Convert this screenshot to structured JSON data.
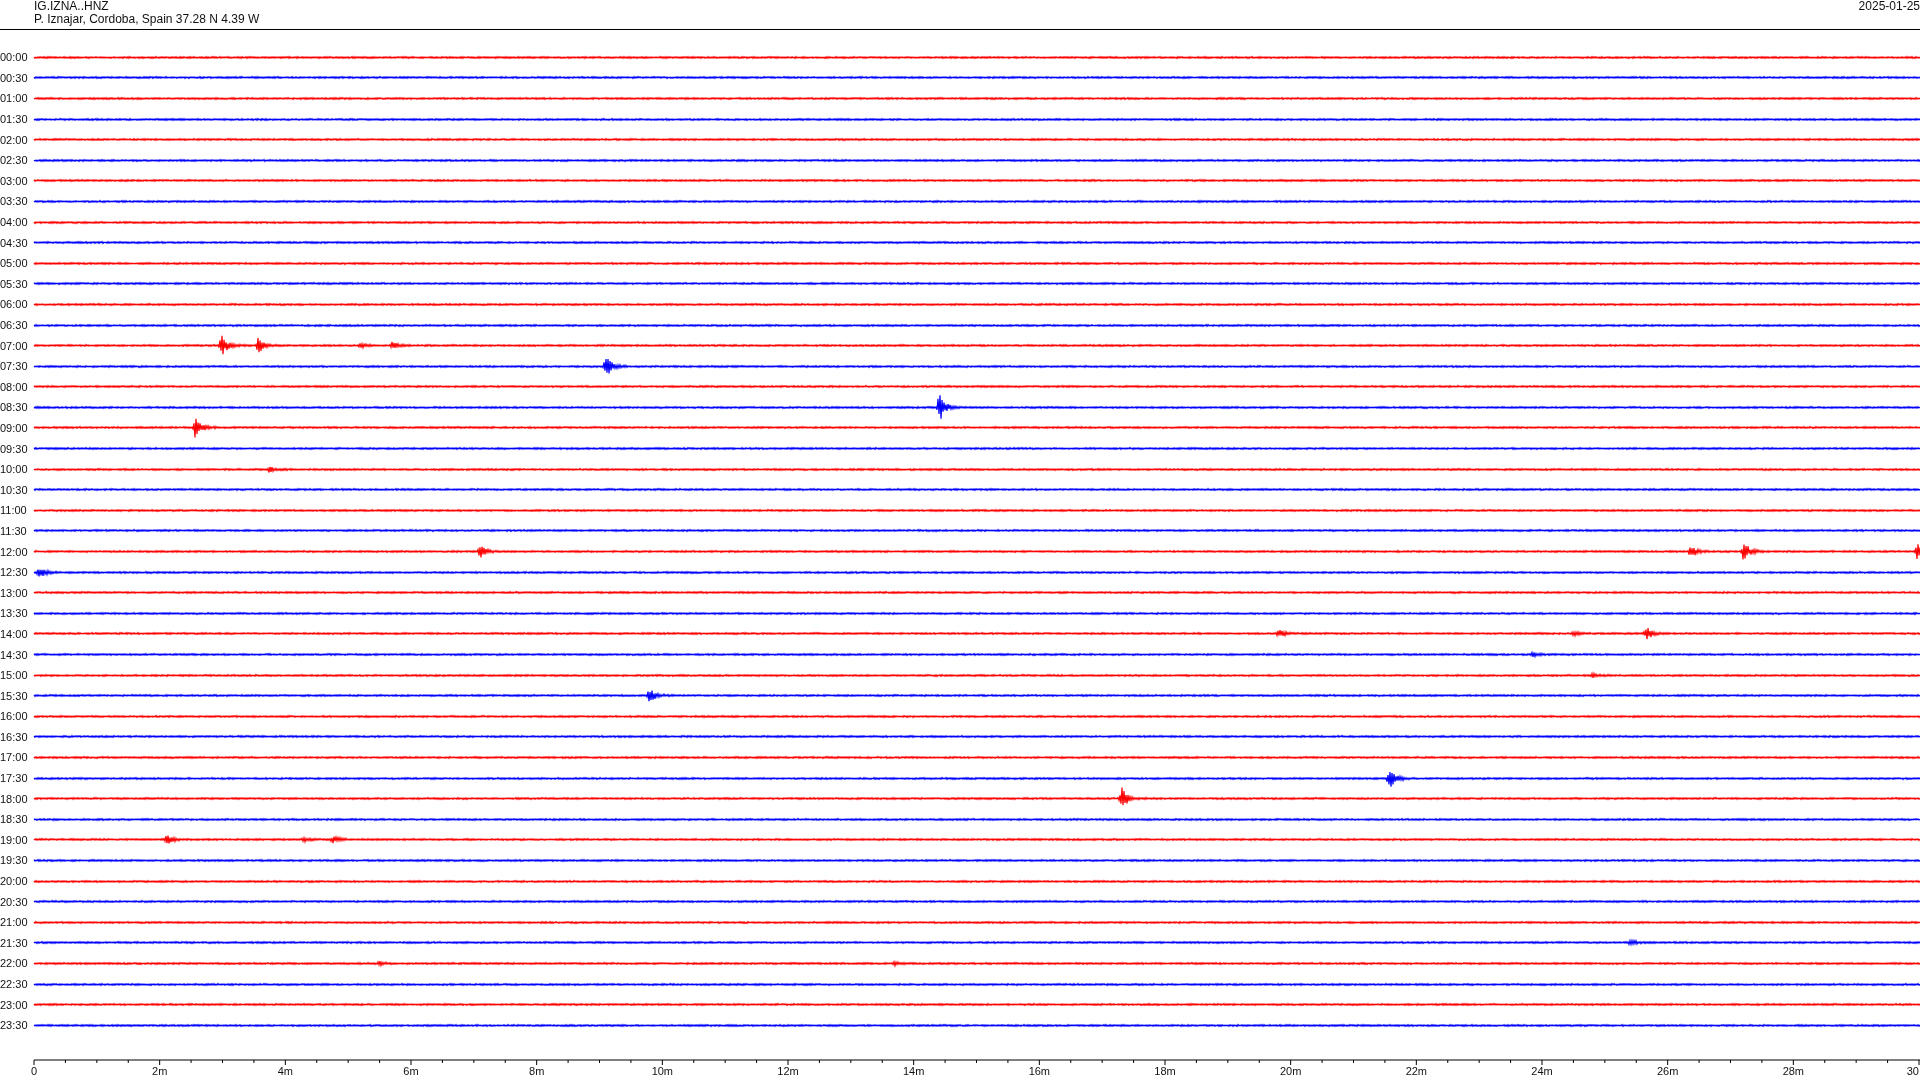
{
  "header": {
    "station": "IG.IZNA..HNZ",
    "location": "P. Iznajar, Cordoba, Spain  37.28 N 4.39 W",
    "date": "2025-01-25"
  },
  "traces": [
    {
      "label": "00:00",
      "color": "#ff0000"
    },
    {
      "label": "00:30",
      "color": "#0000ff"
    },
    {
      "label": "01:00",
      "color": "#ff0000"
    },
    {
      "label": "01:30",
      "color": "#0000ff"
    },
    {
      "label": "02:00",
      "color": "#ff0000"
    },
    {
      "label": "02:30",
      "color": "#0000ff"
    },
    {
      "label": "03:00",
      "color": "#ff0000"
    },
    {
      "label": "03:30",
      "color": "#0000ff"
    },
    {
      "label": "04:00",
      "color": "#ff0000"
    },
    {
      "label": "04:30",
      "color": "#0000ff"
    },
    {
      "label": "05:00",
      "color": "#ff0000"
    },
    {
      "label": "05:30",
      "color": "#0000ff"
    },
    {
      "label": "06:00",
      "color": "#ff0000"
    },
    {
      "label": "06:30",
      "color": "#0000ff"
    },
    {
      "label": "07:00",
      "color": "#ff0000"
    },
    {
      "label": "07:30",
      "color": "#0000ff"
    },
    {
      "label": "08:00",
      "color": "#ff0000"
    },
    {
      "label": "08:30",
      "color": "#0000ff"
    },
    {
      "label": "09:00",
      "color": "#ff0000"
    },
    {
      "label": "09:30",
      "color": "#0000ff"
    },
    {
      "label": "10:00",
      "color": "#ff0000"
    },
    {
      "label": "10:30",
      "color": "#0000ff"
    },
    {
      "label": "11:00",
      "color": "#ff0000"
    },
    {
      "label": "11:30",
      "color": "#0000ff"
    },
    {
      "label": "12:00",
      "color": "#ff0000"
    },
    {
      "label": "12:30",
      "color": "#0000ff"
    },
    {
      "label": "13:00",
      "color": "#ff0000"
    },
    {
      "label": "13:30",
      "color": "#0000ff"
    },
    {
      "label": "14:00",
      "color": "#ff0000"
    },
    {
      "label": "14:30",
      "color": "#0000ff"
    },
    {
      "label": "15:00",
      "color": "#ff0000"
    },
    {
      "label": "15:30",
      "color": "#0000ff"
    },
    {
      "label": "16:00",
      "color": "#ff0000"
    },
    {
      "label": "16:30",
      "color": "#0000ff"
    },
    {
      "label": "17:00",
      "color": "#ff0000"
    },
    {
      "label": "17:30",
      "color": "#0000ff"
    },
    {
      "label": "18:00",
      "color": "#ff0000"
    },
    {
      "label": "18:30",
      "color": "#0000ff"
    },
    {
      "label": "19:00",
      "color": "#ff0000"
    },
    {
      "label": "19:30",
      "color": "#0000ff"
    },
    {
      "label": "20:00",
      "color": "#ff0000"
    },
    {
      "label": "20:30",
      "color": "#0000ff"
    },
    {
      "label": "21:00",
      "color": "#ff0000"
    },
    {
      "label": "21:30",
      "color": "#0000ff"
    },
    {
      "label": "22:00",
      "color": "#ff0000"
    },
    {
      "label": "22:30",
      "color": "#0000ff"
    },
    {
      "label": "23:00",
      "color": "#ff0000"
    },
    {
      "label": "23:30",
      "color": "#0000ff"
    }
  ],
  "x_axis": {
    "tick_labels": [
      "0",
      "2m",
      "4m",
      "6m",
      "8m",
      "10m",
      "12m",
      "14m",
      "16m",
      "18m",
      "20m",
      "22m",
      "24m",
      "26m",
      "28m",
      "30"
    ]
  }
}
